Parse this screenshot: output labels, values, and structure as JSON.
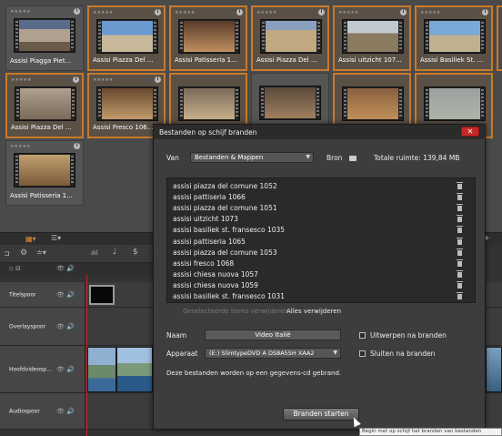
{
  "library": {
    "thumbnails": [
      {
        "label": "Assisi Piagga Piet...",
        "stars": "★★★★★",
        "selected": false
      },
      {
        "label": "Assisi Piazza Del ...",
        "stars": "★★★★★",
        "selected": true
      },
      {
        "label": "Assisi Patisseria 1...",
        "stars": "★★★★★",
        "selected": true
      },
      {
        "label": "Assisi Piazza Del ...",
        "stars": "★★★★★",
        "selected": true
      },
      {
        "label": "Assisi uitzicht 107...",
        "stars": "★★★★★",
        "selected": true
      },
      {
        "label": "Assisi Basiliek St. ...",
        "stars": "★★★★★",
        "selected": true
      },
      {
        "label": "Assisi Piazza Del ...",
        "stars": "★★★★★",
        "selected": true
      },
      {
        "label": "Assisi Fresco 106...",
        "stars": "★★★★★",
        "selected": true
      },
      {
        "label": "Assisi Patisseria 1...",
        "stars": "★★★★★",
        "selected": false
      }
    ]
  },
  "timeline": {
    "tracks": [
      {
        "name": "Titelspoor"
      },
      {
        "name": "Overlayspoor"
      },
      {
        "name": "Hoofdvideosp..."
      },
      {
        "name": "Audiospoor"
      }
    ]
  },
  "dialog": {
    "title": "Bestanden op schijf branden",
    "close_label": "✕",
    "van_label": "Van",
    "van_value": "Bestanden & Mappen",
    "bron_label": "Bron",
    "totale_ruimte": "Totale ruimte:  139,84 MB",
    "files": [
      "assisi piazza del comune 1052",
      "assisi pattiseria 1066",
      "assisi piazza del comune 1051",
      "assisi uitzicht 1073",
      "assisi basiliek st.  fransesco 1035",
      "assisi pattiseria 1065",
      "assisi piazza del comune 1053",
      "assisi fresco 1068",
      "assisi chiesa nuova 1057",
      "assisi chiesa nuova 1059",
      "assisi basiliek st.  fransesco 1031"
    ],
    "remove_selected_label": "Geselecteerde items verwijderen",
    "remove_all_label": "Alles verwijderen",
    "naam_label": "Naam",
    "naam_value": "Video Italië",
    "apparaat_label": "Apparaat",
    "apparaat_value": "(E:) SlimtypeDVD A  DS8A5SH  XAA2",
    "uitwerpen_label": "Uitwerpen na branden",
    "sluiten_label": "Sluiten na branden",
    "info_text": "Deze bestanden worden op een gegevens-cd gebrand.",
    "start_label": "Branden starten",
    "tooltip": "Begin met op schijf het branden van bestanden"
  }
}
